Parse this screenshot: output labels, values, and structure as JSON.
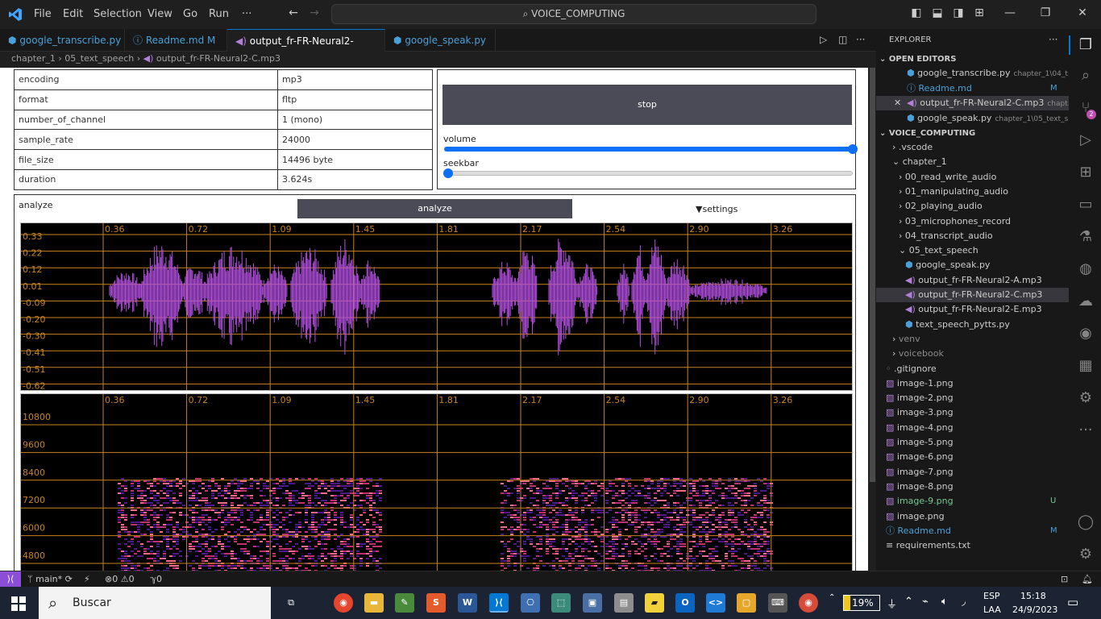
{
  "menu": {
    "file": "File",
    "edit": "Edit",
    "selection": "Selection",
    "view": "View",
    "go": "Go",
    "run": "Run",
    "more": "···"
  },
  "command_center": "VOICE_COMPUTING",
  "tabs": [
    {
      "label": "google_transcribe.py",
      "suffix": ""
    },
    {
      "label": "Readme.md",
      "suffix": "M"
    },
    {
      "label": "output_fr-FR-Neural2-C.mp3",
      "suffix": "×"
    },
    {
      "label": "google_speak.py",
      "suffix": ""
    }
  ],
  "breadcrumb": [
    "chapter_1",
    "05_text_speech",
    "output_fr-FR-Neural2-C.mp3"
  ],
  "info_table": [
    {
      "key": "encoding",
      "value": "mp3"
    },
    {
      "key": "format",
      "value": "fltp"
    },
    {
      "key": "number_of_channel",
      "value": "1 (mono)"
    },
    {
      "key": "sample_rate",
      "value": "24000"
    },
    {
      "key": "file_size",
      "value": "14496 byte"
    },
    {
      "key": "duration",
      "value": "3.624s"
    }
  ],
  "player": {
    "stop_label": "stop",
    "volume_label": "volume",
    "seekbar_label": "seekbar",
    "volume_level": 1.0,
    "seek_level": 0.0
  },
  "analyze": {
    "title": "analyze",
    "button_label": "analyze",
    "settings_label": "▼settings"
  },
  "waveform": {
    "time_ticks": [
      "0.36",
      "0.72",
      "1.09",
      "1.45",
      "1.81",
      "2.17",
      "2.54",
      "2.90",
      "3.26"
    ],
    "amp_ticks": [
      "0.33",
      "0.22",
      "0.12",
      "0.01",
      "-0.09",
      "-0.20",
      "-0.30",
      "-0.41",
      "-0.51",
      "-0.62"
    ],
    "wave_color": "#b34fe0",
    "grid_color": "#c8831b"
  },
  "spectrogram": {
    "time_ticks": [
      "0.36",
      "0.72",
      "1.09",
      "1.45",
      "1.81",
      "2.17",
      "2.54",
      "2.90",
      "3.26"
    ],
    "freq_ticks": [
      "10800",
      "9600",
      "8400",
      "7200",
      "6000",
      "4800"
    ]
  },
  "explorer": {
    "header": "EXPLORER",
    "open_editors_title": "OPEN EDITORS",
    "open_editors": [
      {
        "name": "google_transcribe.py",
        "desc": "chapter_1\\04_t...",
        "badge": ""
      },
      {
        "name": "Readme.md",
        "desc": "",
        "badge": "M"
      },
      {
        "name": "output_fr-FR-Neural2-C.mp3",
        "desc": "chapt...",
        "badge": ""
      },
      {
        "name": "google_speak.py",
        "desc": "chapter_1\\05_text_s...",
        "badge": ""
      }
    ],
    "workspace_title": "VOICE_COMPUTING",
    "tree": [
      {
        "name": ".vscode",
        "depth": 1,
        "type": "folder"
      },
      {
        "name": "chapter_1",
        "depth": 1,
        "type": "folder-open"
      },
      {
        "name": "00_read_write_audio",
        "depth": 2,
        "type": "folder"
      },
      {
        "name": "01_manipulating_audio",
        "depth": 2,
        "type": "folder"
      },
      {
        "name": "02_playing_audio",
        "depth": 2,
        "type": "folder"
      },
      {
        "name": "03_microphones_record",
        "depth": 2,
        "type": "folder"
      },
      {
        "name": "04_transcript_audio",
        "depth": 2,
        "type": "folder"
      },
      {
        "name": "05_text_speech",
        "depth": 2,
        "type": "folder-open"
      },
      {
        "name": "google_speak.py",
        "depth": 3,
        "type": "py"
      },
      {
        "name": "output_fr-FR-Neural2-A.mp3",
        "depth": 3,
        "type": "mp3"
      },
      {
        "name": "output_fr-FR-Neural2-C.mp3",
        "depth": 3,
        "type": "mp3"
      },
      {
        "name": "output_fr-FR-Neural2-E.mp3",
        "depth": 3,
        "type": "mp3"
      },
      {
        "name": "text_speech_pytts.py",
        "depth": 3,
        "type": "py"
      },
      {
        "name": "venv",
        "depth": 1,
        "type": "folder"
      },
      {
        "name": "voicebook",
        "depth": 1,
        "type": "folder"
      },
      {
        "name": ".gitignore",
        "depth": 0,
        "type": "file"
      },
      {
        "name": "image-1.png",
        "depth": 0,
        "type": "png"
      },
      {
        "name": "image-2.png",
        "depth": 0,
        "type": "png"
      },
      {
        "name": "image-3.png",
        "depth": 0,
        "type": "png"
      },
      {
        "name": "image-4.png",
        "depth": 0,
        "type": "png"
      },
      {
        "name": "image-5.png",
        "depth": 0,
        "type": "png"
      },
      {
        "name": "image-6.png",
        "depth": 0,
        "type": "png"
      },
      {
        "name": "image-7.png",
        "depth": 0,
        "type": "png"
      },
      {
        "name": "image-8.png",
        "depth": 0,
        "type": "png"
      },
      {
        "name": "image-9.png",
        "depth": 0,
        "type": "png",
        "badge": "U"
      },
      {
        "name": "image.png",
        "depth": 0,
        "type": "png"
      },
      {
        "name": "Readme.md",
        "depth": 0,
        "type": "md",
        "badge": "M"
      },
      {
        "name": "requirements.txt",
        "depth": 0,
        "type": "txt"
      }
    ]
  },
  "status": {
    "branch": "main*",
    "errors": "0",
    "warnings": "0",
    "ports": "0"
  },
  "taskbar": {
    "search_placeholder": "Buscar",
    "battery": "19%",
    "lang": "ESP",
    "lang2": "LAA",
    "time": "15:18",
    "date": "24/9/2023"
  },
  "colors": {
    "accent": "#0078d4",
    "scm_badge": "#c24fb0"
  }
}
